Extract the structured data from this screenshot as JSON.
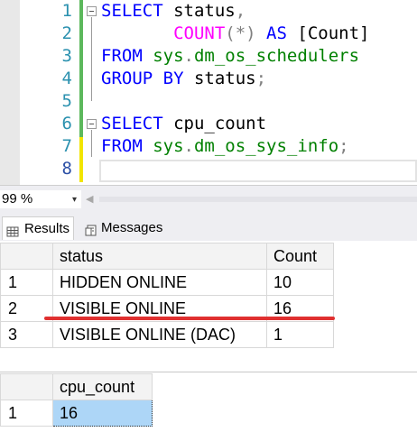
{
  "editor": {
    "lines": [
      {
        "num": "1",
        "tokens": [
          {
            "t": "SELECT",
            "c": "kw"
          },
          {
            "t": " status",
            "c": "plain"
          },
          {
            "t": ",",
            "c": "op"
          }
        ]
      },
      {
        "num": "2",
        "tokens": [
          {
            "t": "       ",
            "c": "plain"
          },
          {
            "t": "COUNT",
            "c": "fn"
          },
          {
            "t": "(*)",
            "c": "op"
          },
          {
            "t": " AS ",
            "c": "kw"
          },
          {
            "t": "[Count]",
            "c": "plain"
          }
        ]
      },
      {
        "num": "3",
        "tokens": [
          {
            "t": "FROM ",
            "c": "kw"
          },
          {
            "t": "sys",
            "c": "obj"
          },
          {
            "t": ".",
            "c": "op"
          },
          {
            "t": "dm_os_schedulers",
            "c": "obj"
          }
        ]
      },
      {
        "num": "4",
        "tokens": [
          {
            "t": "GROUP BY ",
            "c": "kw"
          },
          {
            "t": "status",
            "c": "plain"
          },
          {
            "t": ";",
            "c": "op"
          }
        ]
      },
      {
        "num": "5",
        "tokens": []
      },
      {
        "num": "6",
        "tokens": [
          {
            "t": "SELECT",
            "c": "kw"
          },
          {
            "t": " cpu_count",
            "c": "plain"
          }
        ]
      },
      {
        "num": "7",
        "tokens": [
          {
            "t": "FROM ",
            "c": "kw"
          },
          {
            "t": "sys",
            "c": "obj"
          },
          {
            "t": ".",
            "c": "op"
          },
          {
            "t": "dm_os_sys_info",
            "c": "obj"
          },
          {
            "t": ";",
            "c": "op"
          }
        ]
      },
      {
        "num": "8",
        "tokens": []
      }
    ]
  },
  "status_bar": {
    "zoom": "99 %",
    "zoom_arrow": "▾",
    "scroll_left": "◀"
  },
  "tabs": {
    "results_label": "Results",
    "messages_label": "Messages"
  },
  "grid1": {
    "headers": [
      "status",
      "Count"
    ],
    "rows": [
      {
        "num": "1",
        "cells": [
          "HIDDEN ONLINE",
          "10"
        ]
      },
      {
        "num": "2",
        "cells": [
          "VISIBLE ONLINE",
          "16"
        ]
      },
      {
        "num": "3",
        "cells": [
          "VISIBLE ONLINE (DAC)",
          "1"
        ]
      }
    ]
  },
  "grid2": {
    "headers": [
      "cpu_count"
    ],
    "rows": [
      {
        "num": "1",
        "cells": [
          "16"
        ]
      }
    ]
  },
  "colors": {
    "keyword": "#0000ff",
    "function": "#ff00ff",
    "system_object": "#008000",
    "selection": "#add6f7",
    "highlight_underline": "#e03030"
  }
}
